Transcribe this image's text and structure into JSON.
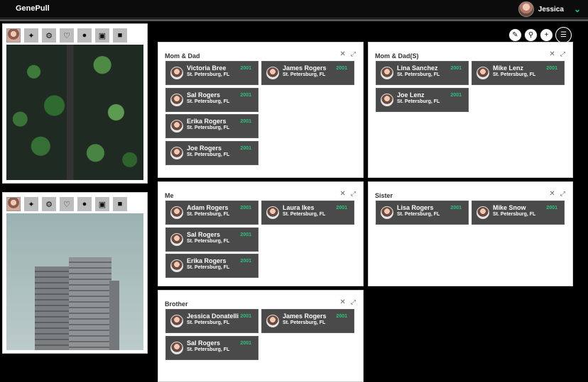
{
  "app": {
    "title": "GenePull"
  },
  "user": {
    "name": "Jessica"
  },
  "colors": {
    "accent": "#2ec27e",
    "card": "#4a4a4a"
  },
  "toolbar": {
    "icons": [
      "edit-icon",
      "search-icon",
      "plus-icon",
      "menu-icon"
    ]
  },
  "image_cards": [
    {
      "icons": [
        "avatar",
        "puzzle-icon",
        "network-icon",
        "heart-icon",
        "person-icon",
        "cake-icon",
        "briefcase-icon"
      ]
    },
    {
      "icons": [
        "avatar",
        "puzzle-icon",
        "network-icon",
        "heart-icon",
        "person-icon",
        "cake-icon",
        "briefcase-icon"
      ]
    }
  ],
  "panels": [
    {
      "title": "Mom & Dad",
      "people": [
        {
          "name": "Victoria Bree",
          "loc": "St. Petersburg, FL",
          "year": "2001"
        },
        {
          "name": "James Rogers",
          "loc": "St. Petersburg, FL",
          "year": "2001"
        },
        {
          "name": "Sal Rogers",
          "loc": "St. Petersburg, FL",
          "year": "2001"
        },
        {
          "name": "Erika Rogers",
          "loc": "St. Petersburg, FL",
          "year": "2001"
        },
        {
          "name": "Joe Rogers",
          "loc": "St. Petersburg, FL",
          "year": "2001"
        }
      ]
    },
    {
      "title": "Mom & Dad(S)",
      "people": [
        {
          "name": "Lina Sanchez",
          "loc": "St. Petersburg, FL",
          "year": "2001"
        },
        {
          "name": "Mike Lenz",
          "loc": "St. Petersburg, FL",
          "year": "2001"
        },
        {
          "name": "Joe Lenz",
          "loc": "St. Petersburg, FL",
          "year": "2001"
        }
      ]
    },
    {
      "title": "Me",
      "people": [
        {
          "name": "Adam Rogers",
          "loc": "St. Petersburg, FL",
          "year": "2001"
        },
        {
          "name": "Laura Ikes",
          "loc": "St. Petersburg, FL",
          "year": "2001"
        },
        {
          "name": "Sal Rogers",
          "loc": "St. Petersburg, FL",
          "year": "2001"
        },
        {
          "name": "Erika Rogers",
          "loc": "St. Petersburg, FL",
          "year": "2001"
        }
      ]
    },
    {
      "title": "Sister",
      "people": [
        {
          "name": "Lisa Rogers",
          "loc": "St. Petersburg, FL",
          "year": "2001"
        },
        {
          "name": "Mike Snow",
          "loc": "St. Petersburg, FL",
          "year": "2001"
        }
      ]
    },
    {
      "title": "Brother",
      "people": [
        {
          "name": "Jessica Donatelli",
          "loc": "St. Petersburg, FL",
          "year": "2001"
        },
        {
          "name": "James Rogers",
          "loc": "St. Petersburg, FL",
          "year": "2001"
        },
        {
          "name": "Sal Rogers",
          "loc": "St. Petersburg, FL",
          "year": "2001"
        }
      ]
    }
  ]
}
